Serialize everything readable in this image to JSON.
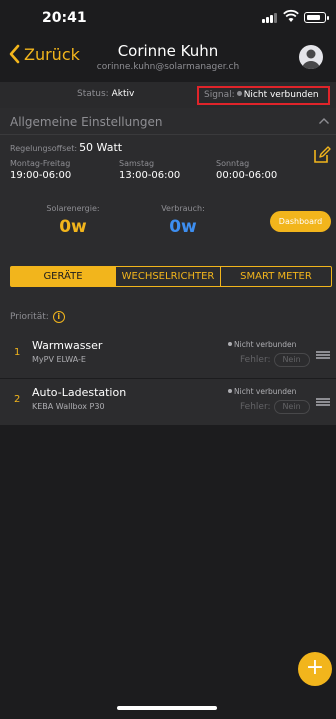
{
  "status_bar": {
    "time": "20:41"
  },
  "header": {
    "back_label": "Zurück",
    "title": "Corinne Kuhn",
    "subtitle": "corinne.kuhn@solarmanager.ch"
  },
  "status_row": {
    "status_label": "Status:",
    "status_value": "Aktiv",
    "signal_label": "Signal:",
    "signal_value": "Nicht verbunden"
  },
  "settings": {
    "heading": "Allgemeine Einstellungen",
    "offset_label": "Regelungsoffset:",
    "offset_value": "50 Watt",
    "schedule": [
      {
        "label": "Montag-Freitag",
        "value": "19:00-06:00"
      },
      {
        "label": "Samstag",
        "value": "13:00-06:00"
      },
      {
        "label": "Sonntag",
        "value": "00:00-06:00"
      }
    ],
    "solar_label": "Solarenergie:",
    "solar_value": "0w",
    "consumption_label": "Verbrauch:",
    "consumption_value": "0w",
    "dashboard_label": "Dashboard"
  },
  "tabs": [
    {
      "label": "GERÄTE",
      "active": true
    },
    {
      "label": "WECHSELRICHTER",
      "active": false
    },
    {
      "label": "SMART METER",
      "active": false
    }
  ],
  "priority_label": "Priorität:",
  "devices": [
    {
      "index": "1",
      "name": "Warmwasser",
      "model": "MyPV ELWA-E",
      "connection": "Nicht verbunden",
      "error_label": "Fehler:",
      "error_value": "Nein"
    },
    {
      "index": "2",
      "name": "Auto-Ladestation",
      "model": "KEBA Wallbox P30",
      "connection": "Nicht verbunden",
      "error_label": "Fehler:",
      "error_value": "Nein"
    }
  ],
  "fab_label": "+",
  "colors": {
    "accent": "#f2b51c",
    "consumption": "#3d8ef0",
    "highlight_border": "#e0242a",
    "background": "#1c1c1e",
    "panel": "#2c2c2e"
  }
}
